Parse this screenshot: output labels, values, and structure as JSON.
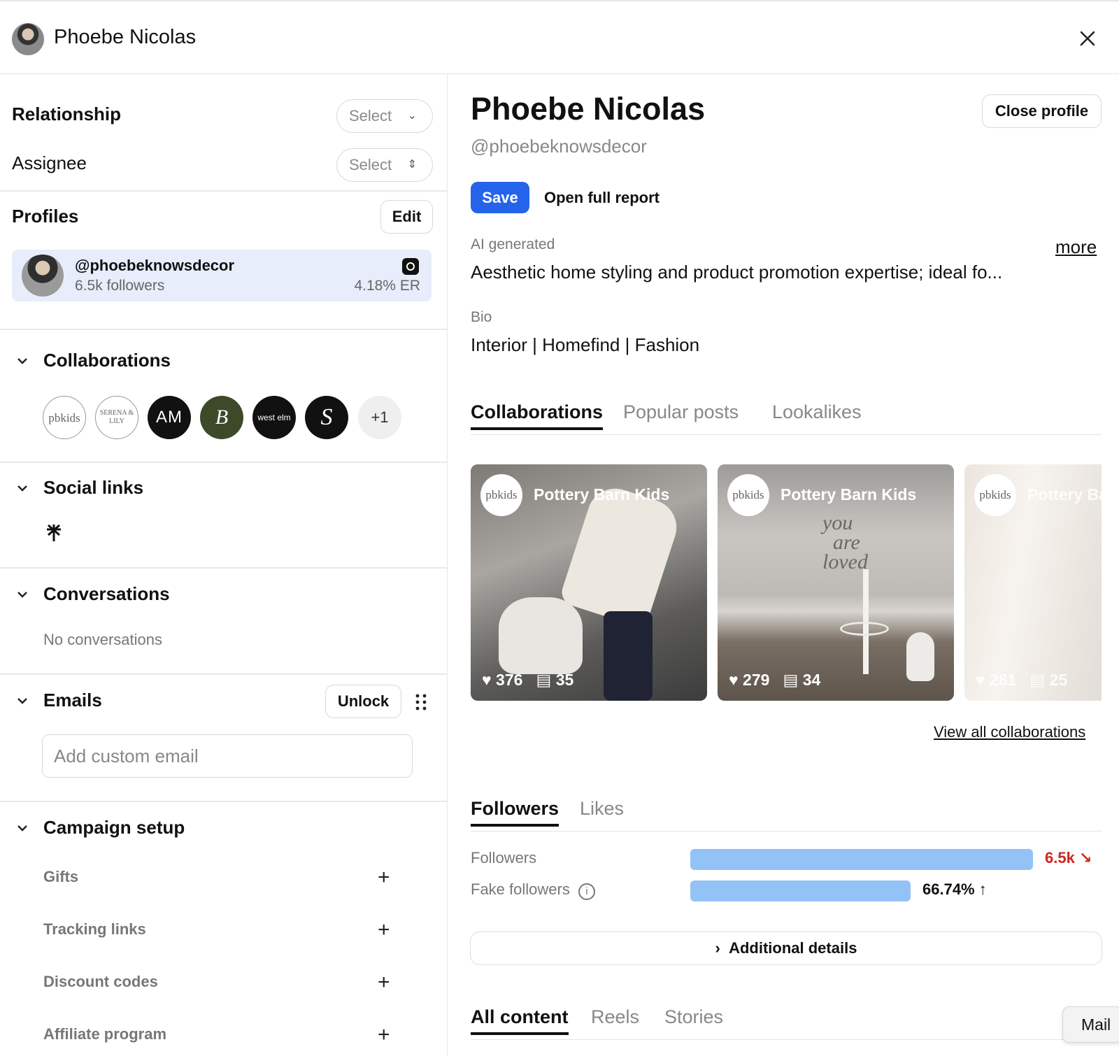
{
  "header": {
    "name": "Phoebe Nicolas",
    "close_icon": "close-icon"
  },
  "left": {
    "relationship": {
      "label": "Relationship",
      "value": "Select"
    },
    "assignee": {
      "label": "Assignee",
      "value": "Select"
    },
    "profiles": {
      "title": "Profiles",
      "edit_label": "Edit",
      "card": {
        "handle": "@phoebeknowsdecor",
        "followers": "6.5k followers",
        "er": "4.18% ER",
        "platform_icon": "instagram-icon"
      }
    },
    "collaborations": {
      "title": "Collaborations",
      "logos": [
        "pbkids",
        "SERENA & LILY",
        "AM",
        "B",
        "west elm",
        "S"
      ],
      "more": "+1"
    },
    "social_links": {
      "title": "Social links",
      "icon": "linktree-icon"
    },
    "conversations": {
      "title": "Conversations",
      "empty": "No conversations"
    },
    "emails": {
      "title": "Emails",
      "unlock_label": "Unlock",
      "placeholder": "Add custom email"
    },
    "campaign": {
      "title": "Campaign setup",
      "items": [
        "Gifts",
        "Tracking links",
        "Discount codes",
        "Affiliate program"
      ]
    }
  },
  "right": {
    "name": "Phoebe Nicolas",
    "handle": "@phoebeknowsdecor",
    "close_profile": "Close profile",
    "save_label": "Save",
    "open_report": "Open full report",
    "ai_label": "AI generated",
    "ai_text": "Aesthetic home styling and product promotion expertise; ideal fo...",
    "more_label": "more",
    "bio_label": "Bio",
    "bio_text": "Interior | Homefind | Fashion",
    "content_tabs": [
      "Collaborations",
      "Popular posts",
      "Lookalikes"
    ],
    "posts": [
      {
        "brand_logo": "pbkids",
        "brand": "Pottery Barn Kids",
        "likes": "376",
        "comments": "35"
      },
      {
        "brand_logo": "pbkids",
        "brand": "Pottery Barn Kids",
        "likes": "279",
        "comments": "34"
      },
      {
        "brand_logo": "pbkids",
        "brand": "Pottery Ba",
        "likes": "281",
        "comments": "25"
      }
    ],
    "view_all": "View all collaborations",
    "audience_tabs": [
      "Followers",
      "Likes"
    ],
    "metrics": [
      {
        "label": "Followers",
        "value": "6.5k",
        "trend": "↘",
        "fill": 1.0,
        "color": "#d0271d"
      },
      {
        "label": "Fake followers",
        "value": "66.74%",
        "trend": "↑",
        "fill": 0.643,
        "color": "#111111"
      }
    ],
    "additional_details": "Additional details",
    "media_tabs": [
      "All content",
      "Reels",
      "Stories"
    ],
    "mail_tooltip": "Mail"
  }
}
